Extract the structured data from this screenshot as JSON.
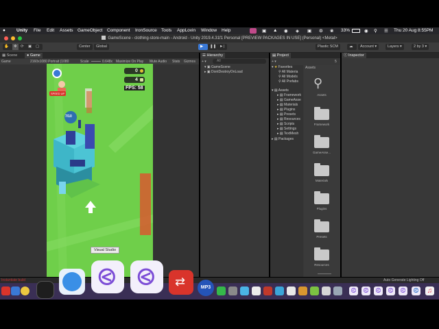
{
  "menubar": {
    "app": "Unity",
    "items": [
      "File",
      "Edit",
      "Assets",
      "GameObject",
      "Component",
      "IronSource",
      "Tools",
      "AppLovin",
      "Window",
      "Help"
    ],
    "battery": "33%",
    "clock": "Thu 20 Aug  8:55PM"
  },
  "window": {
    "title": "GameScene - clothing-store-main - Android - Unity 2019.4.31f1 Personal [PREVIEW PACKAGES IN USE] (Personal) <Metal>"
  },
  "toolbar": {
    "center": "Center",
    "global": "Global",
    "plastic": "Plastic SCM",
    "account": "Account",
    "layers": "Layers",
    "layout": "2 by 3"
  },
  "scene_panel": {
    "tab_scene": "Scene",
    "tab_game": "Game",
    "display": "Game",
    "resolution": "2160x1080 Portrait (1080",
    "scale_label": "Scale",
    "scale_value": "0.648x",
    "maximize": "Maximize On Play",
    "mute": "Mute Audio",
    "stats": "Stats",
    "gizmos": "Gizmos"
  },
  "game": {
    "coins": "0",
    "gems": "4",
    "fps": "FPS: 58",
    "speed_label": "SPEED UP",
    "progress": "7/10",
    "tooltip": "Visual Studio"
  },
  "hierarchy": {
    "tab": "Hierarchy",
    "search_placeholder": "All",
    "items": [
      "GameScene",
      "DontDestroyOnLoad"
    ]
  },
  "project": {
    "tab": "Project",
    "favorites_label": "Favorites",
    "favorites": [
      "All Materia",
      "All Models",
      "All Prefabs"
    ],
    "assets_label": "Assets",
    "asset_tree": [
      "Framework",
      "GameAsse",
      "Materials",
      "Plugins",
      "Presets",
      "Resources",
      "Scripts",
      "Settings",
      "TextMesh"
    ],
    "packages_label": "Packages",
    "breadcrumb": "Assets",
    "grid": [
      "Assets",
      "Framework",
      "GameAsse...",
      "Materials",
      "Plugins",
      "Presets",
      "Resources"
    ],
    "count": "5"
  },
  "inspector": {
    "tab": "Inspector"
  },
  "statusbar": {
    "left": "Instantiate build",
    "right": "Auto Generate Lighting Off"
  },
  "dock": {
    "mp3_label": "MP3"
  },
  "colors": {
    "accent": "#3a79d6",
    "grass": "#6fcf4a",
    "vs_purple": "#7c4dd6"
  }
}
